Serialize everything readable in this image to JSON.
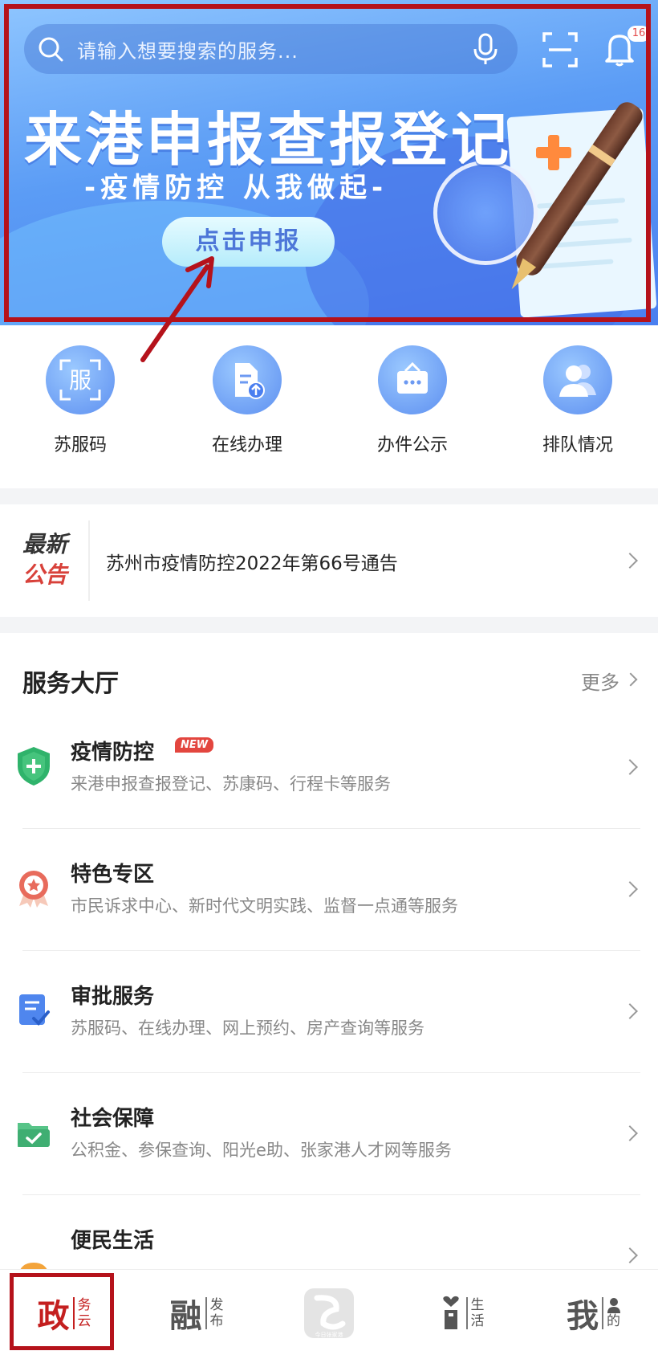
{
  "search": {
    "placeholder": "请输入想要搜索的服务..."
  },
  "notifications": {
    "count": "16"
  },
  "banner": {
    "title": "来港申报查报登记",
    "subtitle": "-疫情防控  从我做起-",
    "button_label": "点击申报"
  },
  "quick_actions": [
    {
      "label": "苏服码",
      "icon": "fu-icon",
      "glyph": "服"
    },
    {
      "label": "在线办理",
      "icon": "document-upload-icon"
    },
    {
      "label": "办件公示",
      "icon": "board-icon"
    },
    {
      "label": "排队情况",
      "icon": "people-icon"
    }
  ],
  "notice": {
    "tag_line1": "最新",
    "tag_line2": "公告",
    "text": "苏州市疫情防控2022年第66号通告"
  },
  "services": {
    "title": "服务大厅",
    "more_label": "更多",
    "new_tag": "NEW",
    "items": [
      {
        "title": "疫情防控",
        "desc": "来港申报查报登记、苏康码、行程卡等服务",
        "icon": "shield-plus-icon"
      },
      {
        "title": "特色专区",
        "desc": "市民诉求中心、新时代文明实践、监督一点通等服务",
        "icon": "medal-icon"
      },
      {
        "title": "审批服务",
        "desc": "苏服码、在线办理、网上预约、房产查询等服务",
        "icon": "approval-doc-icon"
      },
      {
        "title": "社会保障",
        "desc": "公积金、参保查询、阳光e助、张家港人才网等服务",
        "icon": "folder-check-icon"
      },
      {
        "title": "便民生活",
        "desc": "",
        "icon": "convenience-icon"
      }
    ]
  },
  "tabbar": [
    {
      "big": "政",
      "small1": "务",
      "small2": "云",
      "active": true
    },
    {
      "big": "融",
      "small1": "发",
      "small2": "布"
    },
    {
      "center_label": "今日张家港"
    },
    {
      "big": "",
      "small1": "生",
      "small2": "活"
    },
    {
      "big": "我",
      "small1": "",
      "small2": "的"
    }
  ],
  "colors": {
    "accent_red": "#c41f1f",
    "banner_blue": "#5b9cf5",
    "highlight_frame": "#b5121b"
  }
}
